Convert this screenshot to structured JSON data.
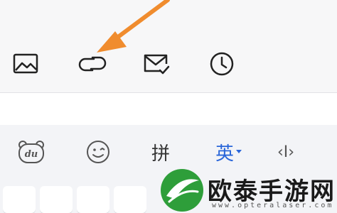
{
  "toolbar": {
    "items": [
      {
        "name": "image-icon"
      },
      {
        "name": "link-icon"
      },
      {
        "name": "mail-check-icon"
      },
      {
        "name": "clock-icon"
      }
    ]
  },
  "ime": {
    "du_label": "du",
    "pinyin_label": "拼",
    "english_label": "英",
    "cursor_label": "‹I›"
  },
  "annotation": {
    "arrow_color": "#f08c2e"
  },
  "watermark": {
    "title": "欧泰手游网",
    "url": "www.opteralaser.com"
  }
}
